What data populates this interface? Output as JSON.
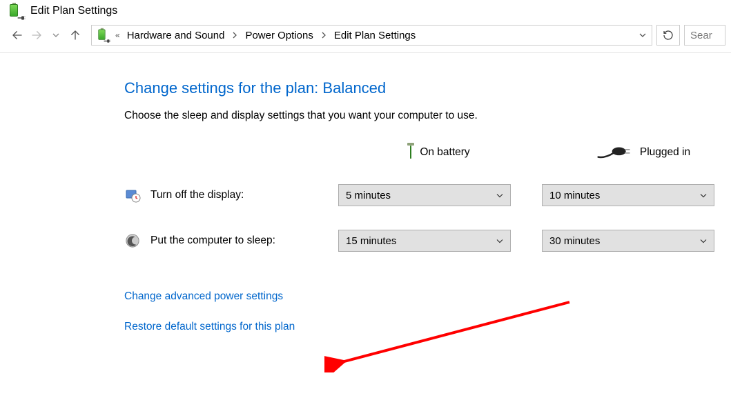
{
  "window": {
    "title": "Edit Plan Settings"
  },
  "breadcrumb": {
    "seg1": "Hardware and Sound",
    "seg2": "Power Options",
    "seg3": "Edit Plan Settings"
  },
  "search": {
    "placeholder": "Sear"
  },
  "page": {
    "heading": "Change settings for the plan: Balanced",
    "subtext": "Choose the sleep and display settings that you want your computer to use."
  },
  "columns": {
    "battery": "On battery",
    "plugged": "Plugged in"
  },
  "rows": {
    "display": {
      "label": "Turn off the display:",
      "battery": "5 minutes",
      "plugged": "10 minutes"
    },
    "sleep": {
      "label": "Put the computer to sleep:",
      "battery": "15 minutes",
      "plugged": "30 minutes"
    }
  },
  "links": {
    "advanced": "Change advanced power settings",
    "restore": "Restore default settings for this plan"
  }
}
